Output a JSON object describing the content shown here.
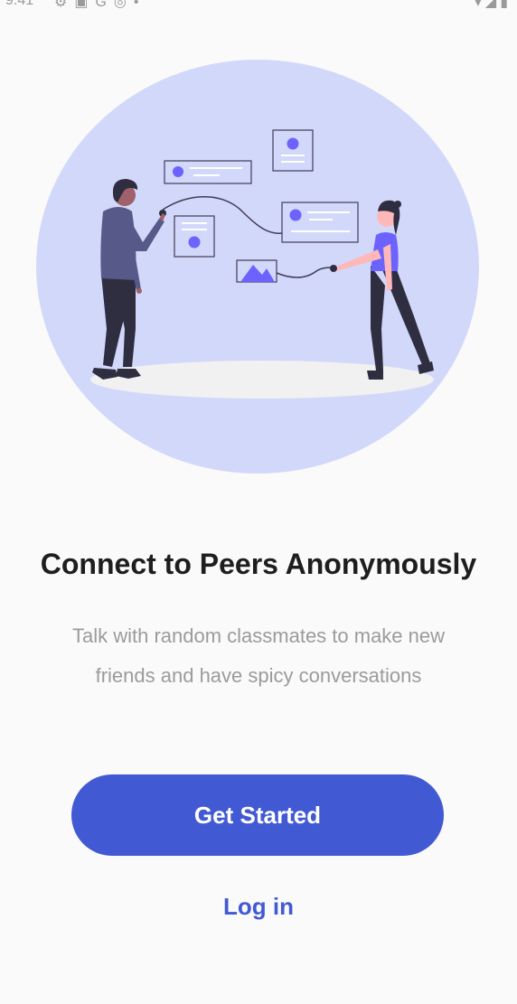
{
  "status_bar": {
    "time": "9:41"
  },
  "hero": {
    "circle_color": "#d2d8fa",
    "accent_color": "#6c63ff"
  },
  "onboarding": {
    "title": "Connect to Peers Anonymously",
    "subtitle": "Talk with random classmates to make new friends and have spicy conversations",
    "get_started_label": "Get Started",
    "login_label": "Log in"
  },
  "theme": {
    "primary": "#4259d4",
    "title_color": "#1e1e1e",
    "subtitle_color": "#9b9b9b",
    "background": "#fafafa"
  }
}
